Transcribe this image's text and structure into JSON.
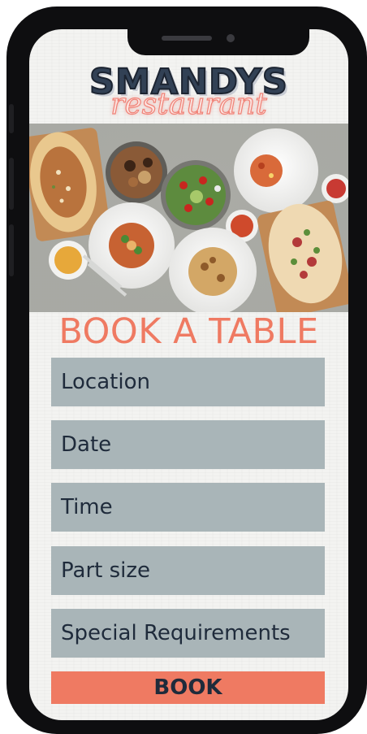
{
  "brand": {
    "name": "SMANDYS",
    "subtitle": "restaurant"
  },
  "page": {
    "title": "BOOK A TABLE"
  },
  "form": {
    "fields": [
      {
        "placeholder": "Location"
      },
      {
        "placeholder": "Date"
      },
      {
        "placeholder": "Time"
      },
      {
        "placeholder": "Part size"
      },
      {
        "placeholder": "Special Requirements"
      }
    ],
    "submit_label": "BOOK"
  },
  "colors": {
    "accent": "#ef7a62",
    "field_bg": "#a9b5b8",
    "text_dark": "#1f2b3b"
  }
}
